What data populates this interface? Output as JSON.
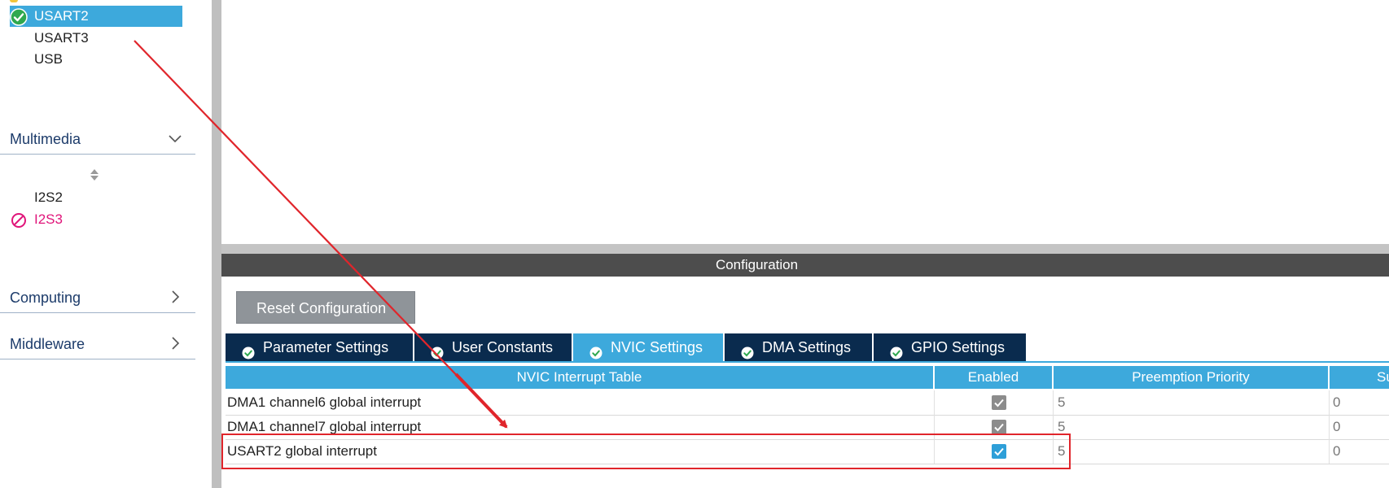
{
  "sidebar": {
    "peripherals": [
      {
        "label": "USART2",
        "state": "enabled",
        "selected": true
      },
      {
        "label": "USART3",
        "state": "none",
        "selected": false
      },
      {
        "label": "USB",
        "state": "none",
        "selected": false
      }
    ],
    "multimedia": {
      "label": "Multimedia",
      "expanded": true,
      "items": [
        {
          "label": "I2S2",
          "state": "none"
        },
        {
          "label": "I2S3",
          "state": "disabled"
        }
      ]
    },
    "computing": {
      "label": "Computing",
      "expanded": false
    },
    "middleware": {
      "label": "Middleware",
      "expanded": false
    }
  },
  "config": {
    "header": "Configuration",
    "reset_button": "Reset Configuration",
    "tabs": [
      {
        "label": "Parameter Settings",
        "active": false
      },
      {
        "label": "User Constants",
        "active": false
      },
      {
        "label": "NVIC Settings",
        "active": true
      },
      {
        "label": "DMA Settings",
        "active": false
      },
      {
        "label": "GPIO Settings",
        "active": false
      }
    ],
    "table": {
      "columns": [
        "NVIC Interrupt Table",
        "Enabled",
        "Preemption Priority",
        "Su"
      ],
      "rows": [
        {
          "name": "DMA1 channel6 global interrupt",
          "enabled": true,
          "editable": false,
          "preemption": "5",
          "sub": "0"
        },
        {
          "name": "DMA1 channel7 global interrupt",
          "enabled": true,
          "editable": false,
          "preemption": "5",
          "sub": "0"
        },
        {
          "name": "USART2 global interrupt",
          "enabled": true,
          "editable": true,
          "preemption": "5",
          "sub": "0"
        }
      ]
    }
  },
  "colors": {
    "accent": "#3da9dc",
    "tab_dark": "#0a2b4e",
    "annotation": "#e0252b",
    "disabled": "#e0157a"
  }
}
